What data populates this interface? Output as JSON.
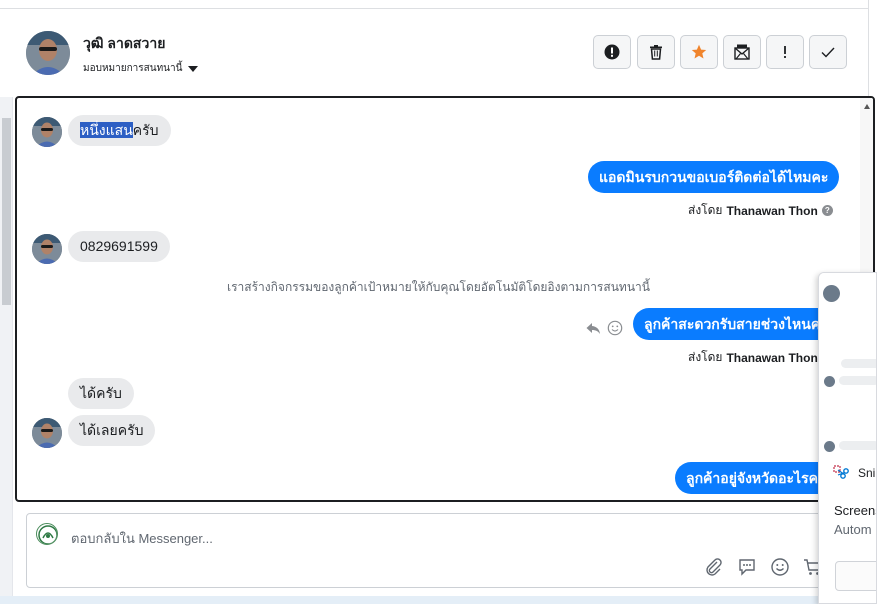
{
  "header": {
    "contact_name": "วุฒิ ลาดสวาย",
    "assign_label": "มอบหมายการสนทนานี้"
  },
  "toolbar": {
    "buttons": [
      "mark-spam",
      "delete",
      "star",
      "mark-unread",
      "important",
      "done"
    ]
  },
  "messages": [
    {
      "direction": "in",
      "text_highlight": "หนึ่งแสน",
      "text_rest": "ครับ"
    },
    {
      "direction": "out",
      "text": "แอดมินรบกวนขอเบอร์ติดต่อได้ไหมคะ",
      "sent_by_label": "ส่งโดย",
      "sent_by_name": "Thanawan Thon"
    },
    {
      "direction": "in",
      "text": "0829691599"
    },
    {
      "direction": "system",
      "text": "เราสร้างกิจกรรมของลูกค้าเป้าหมายให้กับคุณโดยอัตโนมัติโดยอิงตามการสนทนานี้"
    },
    {
      "direction": "out",
      "text": "ลูกค้าสะดวกรับสายช่วงไหนคะ",
      "sent_by_label": "ส่งโดย",
      "sent_by_name": "Thanawan Thon"
    },
    {
      "direction": "in",
      "text": "ได้ครับ"
    },
    {
      "direction": "in",
      "text": "ได้เลยครับ"
    },
    {
      "direction": "out",
      "text": "ลูกค้าอยู่จังหวัดอะไรคะ"
    }
  ],
  "composer": {
    "placeholder": "ตอบกลับใน Messenger..."
  },
  "overlay": {
    "snip_label": "Snip",
    "title": "Screens",
    "subtitle": "Autom"
  },
  "colors": {
    "accent": "#0a7cff",
    "bubble_in": "#e9eaec",
    "star": "#f0842c",
    "highlight": "#2d5fc4"
  }
}
